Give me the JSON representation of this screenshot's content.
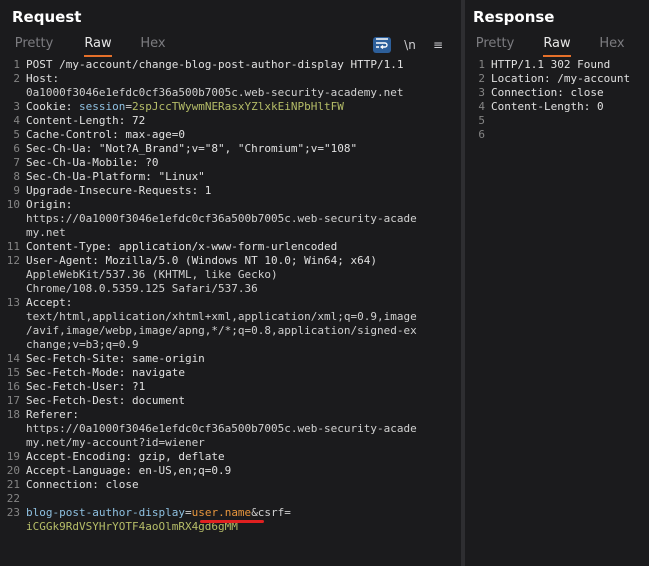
{
  "request": {
    "title": "Request",
    "tabs": [
      "Pretty",
      "Raw",
      "Hex"
    ],
    "active_tab": "Raw",
    "tool_icons": [
      "wrap-icon",
      "newline-icon",
      "menu-icon"
    ],
    "tool_labels": [
      "",
      "\\n",
      "≡"
    ],
    "lines": [
      {
        "n": "1",
        "parts": [
          {
            "t": "POST /my-account/change-blog-post-author-display HTTP/1.1",
            "c": "k"
          }
        ]
      },
      {
        "n": "2",
        "parts": [
          {
            "t": "Host: ",
            "c": "k"
          }
        ]
      },
      {
        "n": "",
        "parts": [
          {
            "t": "0a1000f3046e1efdc0cf36a500b7005c.web-security-academy.net",
            "c": "v"
          }
        ]
      },
      {
        "n": "3",
        "parts": [
          {
            "t": "Cookie: ",
            "c": "k"
          },
          {
            "t": "session",
            "c": "param-k"
          },
          {
            "t": "=",
            "c": "v"
          },
          {
            "t": "2spJccTWywmNERasxYZlxkEiNPbHltFW",
            "c": "g"
          }
        ]
      },
      {
        "n": "4",
        "parts": [
          {
            "t": "Content-Length: 72",
            "c": "k"
          }
        ]
      },
      {
        "n": "5",
        "parts": [
          {
            "t": "Cache-Control: max-age=0",
            "c": "k"
          }
        ]
      },
      {
        "n": "6",
        "parts": [
          {
            "t": "Sec-Ch-Ua: \"Not?A_Brand\";v=\"8\", \"Chromium\";v=\"108\"",
            "c": "k"
          }
        ]
      },
      {
        "n": "7",
        "parts": [
          {
            "t": "Sec-Ch-Ua-Mobile: ?0",
            "c": "k"
          }
        ]
      },
      {
        "n": "8",
        "parts": [
          {
            "t": "Sec-Ch-Ua-Platform: \"Linux\"",
            "c": "k"
          }
        ]
      },
      {
        "n": "9",
        "parts": [
          {
            "t": "Upgrade-Insecure-Requests: 1",
            "c": "k"
          }
        ]
      },
      {
        "n": "10",
        "parts": [
          {
            "t": "Origin: ",
            "c": "k"
          }
        ]
      },
      {
        "n": "",
        "parts": [
          {
            "t": "https://0a1000f3046e1efdc0cf36a500b7005c.web-security-acade",
            "c": "v"
          }
        ]
      },
      {
        "n": "",
        "parts": [
          {
            "t": "my.net",
            "c": "v"
          }
        ]
      },
      {
        "n": "11",
        "parts": [
          {
            "t": "Content-Type: application/x-www-form-urlencoded",
            "c": "k"
          }
        ]
      },
      {
        "n": "12",
        "parts": [
          {
            "t": "User-Agent: Mozilla/5.0 (Windows NT 10.0; Win64; x64)",
            "c": "k"
          }
        ]
      },
      {
        "n": "",
        "parts": [
          {
            "t": "AppleWebKit/537.36 (KHTML, like Gecko)",
            "c": "v"
          }
        ]
      },
      {
        "n": "",
        "parts": [
          {
            "t": "Chrome/108.0.5359.125 Safari/537.36",
            "c": "v"
          }
        ]
      },
      {
        "n": "13",
        "parts": [
          {
            "t": "Accept: ",
            "c": "k"
          }
        ]
      },
      {
        "n": "",
        "parts": [
          {
            "t": "text/html,application/xhtml+xml,application/xml;q=0.9,image",
            "c": "v"
          }
        ]
      },
      {
        "n": "",
        "parts": [
          {
            "t": "/avif,image/webp,image/apng,*/*;q=0.8,application/signed-ex",
            "c": "v"
          }
        ]
      },
      {
        "n": "",
        "parts": [
          {
            "t": "change;v=b3;q=0.9",
            "c": "v"
          }
        ]
      },
      {
        "n": "14",
        "parts": [
          {
            "t": "Sec-Fetch-Site: same-origin",
            "c": "k"
          }
        ]
      },
      {
        "n": "15",
        "parts": [
          {
            "t": "Sec-Fetch-Mode: navigate",
            "c": "k"
          }
        ]
      },
      {
        "n": "16",
        "parts": [
          {
            "t": "Sec-Fetch-User: ?1",
            "c": "k"
          }
        ]
      },
      {
        "n": "17",
        "parts": [
          {
            "t": "Sec-Fetch-Dest: document",
            "c": "k"
          }
        ]
      },
      {
        "n": "18",
        "parts": [
          {
            "t": "Referer: ",
            "c": "k"
          }
        ]
      },
      {
        "n": "",
        "parts": [
          {
            "t": "https://0a1000f3046e1efdc0cf36a500b7005c.web-security-acade",
            "c": "v"
          }
        ]
      },
      {
        "n": "",
        "parts": [
          {
            "t": "my.net/my-account?id=wiener",
            "c": "v"
          }
        ]
      },
      {
        "n": "19",
        "parts": [
          {
            "t": "Accept-Encoding: gzip, deflate",
            "c": "k"
          }
        ]
      },
      {
        "n": "20",
        "parts": [
          {
            "t": "Accept-Language: en-US,en;q=0.9",
            "c": "k"
          }
        ]
      },
      {
        "n": "21",
        "parts": [
          {
            "t": "Connection: close",
            "c": "k"
          }
        ]
      },
      {
        "n": "22",
        "parts": [
          {
            "t": "",
            "c": "k"
          }
        ]
      },
      {
        "n": "23",
        "parts": [
          {
            "t": "blog-post-author-display",
            "c": "param-k"
          },
          {
            "t": "=",
            "c": "v"
          },
          {
            "t": "user.name",
            "c": "o"
          },
          {
            "t": "&csrf=",
            "c": "v"
          }
        ]
      },
      {
        "n": "",
        "parts": [
          {
            "t": "iCGGk9RdVSYHrYOTF4aoOlmRX4gd6gMM",
            "c": "g"
          }
        ]
      }
    ]
  },
  "response": {
    "title": "Response",
    "tabs": [
      "Pretty",
      "Raw",
      "Hex"
    ],
    "active_tab": "Raw",
    "lines": [
      {
        "n": "1",
        "parts": [
          {
            "t": "HTTP/1.1 302 Found",
            "c": "k"
          }
        ]
      },
      {
        "n": "2",
        "parts": [
          {
            "t": "Location: /my-account",
            "c": "k"
          }
        ]
      },
      {
        "n": "3",
        "parts": [
          {
            "t": "Connection: close",
            "c": "k"
          }
        ]
      },
      {
        "n": "4",
        "parts": [
          {
            "t": "Content-Length: 0",
            "c": "k"
          }
        ]
      },
      {
        "n": "5",
        "parts": [
          {
            "t": "",
            "c": "k"
          }
        ]
      },
      {
        "n": "6",
        "parts": [
          {
            "t": "",
            "c": "k"
          }
        ]
      }
    ]
  },
  "colors": {
    "accent": "#e5702a",
    "highlight_underline": "#e02020",
    "string": "#b5bd68",
    "value": "#e6953c"
  }
}
